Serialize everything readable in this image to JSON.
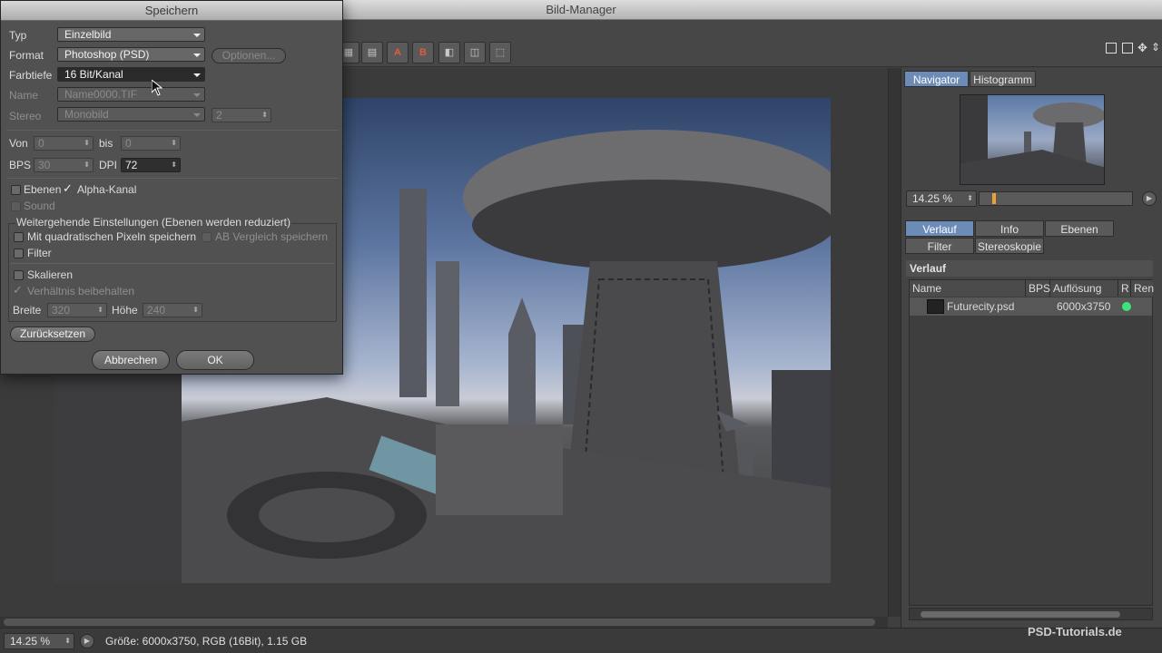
{
  "window": {
    "title": "Bild-Manager"
  },
  "toolbar": {
    "ab_labels": [
      "A",
      "B"
    ]
  },
  "dialog": {
    "title": "Speichern",
    "typ_label": "Typ",
    "typ_value": "Einzelbild",
    "format_label": "Format",
    "format_value": "Photoshop (PSD)",
    "optionen_label": "Optionen...",
    "farbtiefe_label": "Farbtiefe",
    "farbtiefe_value": "16 Bit/Kanal",
    "name_label": "Name",
    "name_value": "Name0000.TIF",
    "stereo_label": "Stereo",
    "stereo_value": "Monobild",
    "stereo_count": "2",
    "von_label": "Von",
    "von_value": "0",
    "bis_label": "bis",
    "bis_value": "0",
    "bps_label": "BPS",
    "bps_value": "30",
    "dpi_label": "DPI",
    "dpi_value": "72",
    "ebenen_label": "Ebenen",
    "alpha_label": "Alpha-Kanal",
    "sound_label": "Sound",
    "group_title": "Weitergehende Einstellungen (Ebenen werden reduziert)",
    "quad_label": "Mit quadratischen Pixeln speichern",
    "ab_label": "AB Vergleich speichern",
    "filter_label": "Filter",
    "skalieren_label": "Skalieren",
    "verhaeltnis_label": "Verhältnis beibehalten",
    "breite_label": "Breite",
    "breite_value": "320",
    "hoehe_label": "Höhe",
    "hoehe_value": "240",
    "reset_label": "Zurücksetzen",
    "cancel_label": "Abbrechen",
    "ok_label": "OK",
    "checked": {
      "ebenen": false,
      "alpha": true,
      "sound": false,
      "quad": false,
      "ab": false,
      "filter": false,
      "skalieren": false,
      "verhaeltnis": true
    }
  },
  "right_panel": {
    "tabs_top": [
      "Navigator",
      "Histogramm"
    ],
    "zoom": "14.25 %",
    "tabs_mid": [
      "Verlauf",
      "Info",
      "Ebenen",
      "Filter",
      "Stereoskopie"
    ],
    "verlauf_title": "Verlauf",
    "columns": [
      "Name",
      "BPS",
      "Auflösung",
      "R",
      "Ren"
    ],
    "rows": [
      {
        "name": "Futurecity.psd",
        "bps": "",
        "resolution": "6000x3750"
      }
    ]
  },
  "status": {
    "zoom": "14.25 %",
    "info": "Größe: 6000x3750, RGB (16Bit), 1.15 GB"
  },
  "watermark": "PSD-Tutorials.de",
  "colors": {
    "accent_tab": "#6d8bb7",
    "status_dot": "#3fe27a",
    "ab_red": "#e25a3c"
  }
}
